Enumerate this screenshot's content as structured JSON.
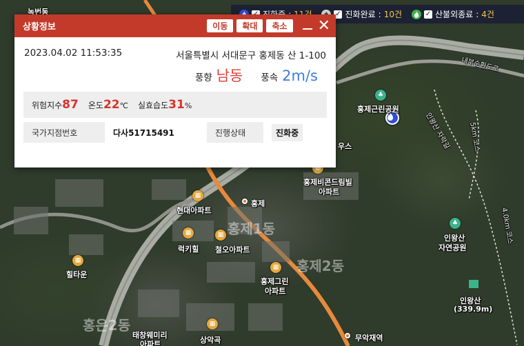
{
  "legend": {
    "items": [
      {
        "icon": "fire-active-icon",
        "label": "진화중",
        "count": "11건"
      },
      {
        "icon": "fire-done-icon",
        "label": "진화완료",
        "count": "10건"
      },
      {
        "icon": "fire-out-icon",
        "label": "산불외종료",
        "count": "4건"
      }
    ],
    "colon": ":"
  },
  "popup": {
    "title": "상황정보",
    "buttons": {
      "move": "이동",
      "expand": "확대",
      "shrink": "축소"
    },
    "datetime": "2023.04.02 11:53:35",
    "address": "서울특별시 서대문구 홍제동 산 1-100",
    "wind_dir_label": "풍향",
    "wind_dir": "남동",
    "wind_speed_label": "풍속",
    "wind_speed": "2m/s",
    "risk": {
      "risk_label": "위험지수",
      "risk_value": "87",
      "temp_label": "온도",
      "temp_value": "22",
      "temp_unit": "℃",
      "humidity_label": "실효습도",
      "humidity_value": "31",
      "humidity_unit": "%"
    },
    "table": {
      "grid_label": "국가지점번호",
      "grid_value": "다사51715491",
      "status_label": "진행상태",
      "status_value": "진화중"
    }
  },
  "map": {
    "labels": {
      "top_left": "녹번동",
      "hongje_park": "홍제근린공원",
      "hyundai_apt": "현대아파트",
      "hongje_station": "홍제",
      "lucky_hill": "럭키힐",
      "cheolo_apt": "철오아파트",
      "hillstown": "힐타운",
      "hongje_green_1": "홍제그린",
      "hongje_green_2": "아파트",
      "hongje_brille_1": "홍제비콘드림빌",
      "hongje_brille_2": "아파트",
      "inwang_park_1": "인왕산",
      "inwang_park_2": "자연공원",
      "inwang_peak_1": "인왕산",
      "inwang_peak_2": "(339.9m)",
      "muak": "무악재역",
      "sangak": "상악곡",
      "taechang_1": "태창웨미리",
      "taechang_2": "아파트",
      "house": "우스",
      "ghost1": "홍제1동",
      "ghost2": "홍제2동",
      "ghost3": "홍은2동",
      "road1": "내부순환도로",
      "road2": "인왕산 자락길",
      "road3": "4km 코스",
      "road4": "5km 코스",
      "road5": "4.0km 코스"
    }
  },
  "colors": {
    "header_red": "#c43a2a",
    "wind_dir": "#e0403a",
    "wind_speed": "#3a7de0",
    "risk_value": "#d8332a",
    "legend_count": "#f6c94a",
    "active_fire": "#2f4fd6"
  }
}
